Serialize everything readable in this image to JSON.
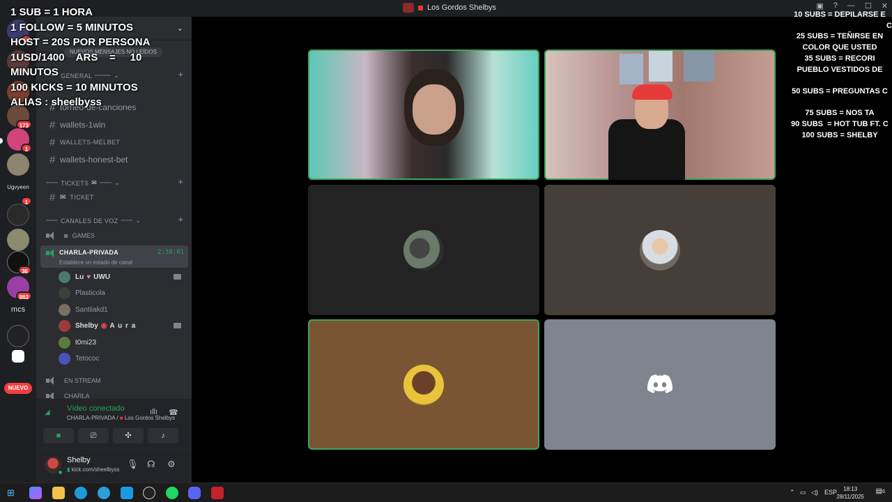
{
  "window": {
    "title": "Los Gordos Shelbys"
  },
  "sidebar": {
    "new_messages": "NUEVOS MENSAJES NO LEÍDOS",
    "categories": {
      "general": "GENERAL",
      "tickets": "TICKETS",
      "voice": "CANALES DE VOZ"
    },
    "text_channels": [
      "torneo-de-canciones",
      "wallets-1win",
      "WALLETS-MELBET",
      "wallets-honest-bet"
    ],
    "ticket_channel": "TICKET",
    "voice_channels": {
      "games": "GAMES",
      "en_stream": "EN STREAM",
      "charla": "CHARLA"
    },
    "active_channel": {
      "name": "CHARLA-PRIVADA",
      "timer": "2:38:01",
      "status": "Establece un estado de canal"
    },
    "members": [
      {
        "name": "Lu",
        "suffix": "UWU"
      },
      {
        "name": "Plasticola",
        "suffix": ""
      },
      {
        "name": "Santiiakd1",
        "suffix": ""
      },
      {
        "name": "Shelby",
        "suffix": "A u r a"
      },
      {
        "name": "t0mi23",
        "suffix": ""
      },
      {
        "name": "Tetococ",
        "suffix": ""
      }
    ]
  },
  "server_rail": {
    "badges": [
      "1",
      "173",
      "1",
      "1",
      "36",
      "863"
    ],
    "mcs_label": "mcs",
    "ubvenn_label": "Ugvyeen",
    "new_label": "NUEVO"
  },
  "voice_panel": {
    "title": "Vídeo conectado",
    "channel": "CHARLA-PRIVADA /",
    "server": "Los Gordos Shelbys"
  },
  "user_panel": {
    "name": "Shelby",
    "status": "kick.com/sheelbyss"
  },
  "overlay_left": [
    "1 SUB = 1 HORA",
    "1 FOLLOW = 5 MINUTOS",
    "HOST = 20S POR PERSONA",
    "1USD/1400    ARS    =     10",
    "MINUTOS",
    "100 KICKS = 10 MINUTOS",
    "ALIAS : sheelbyss"
  ],
  "overlay_right": [
    "10 SUBS = DEPILARSE E",
    "C",
    "25 SUBS = TEÑIRSE EN",
    "COLOR QUE USTED",
    "35 SUBS = RECORI",
    "PUEBLO VESTIDOS DE",
    "",
    "50 SUBS = PREGUNTAS C",
    "",
    "75 SUBS = NOS TA",
    "90 SUBS  = HOT TUB FT. C",
    "100 SUBS = SHELBY"
  ],
  "taskbar": {
    "lang": "ESP",
    "time": "18:13",
    "date": "28/11/2025",
    "notif": "6"
  },
  "colors": {
    "speaking": "#3ba55d",
    "online": "#23a55a",
    "badge": "#f23f43"
  }
}
